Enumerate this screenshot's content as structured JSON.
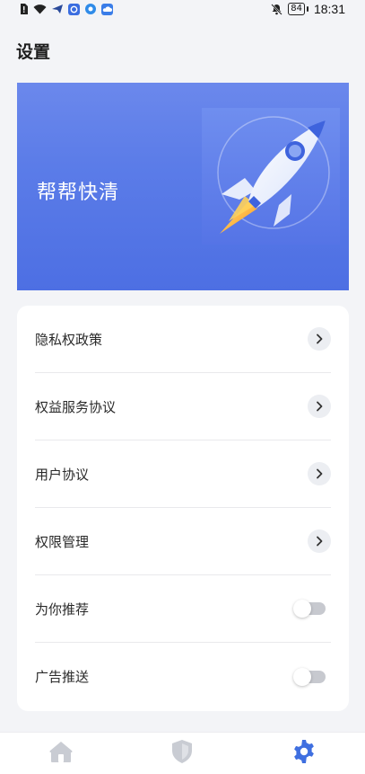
{
  "status_bar": {
    "left_icons": [
      "sim-alert-icon",
      "wifi-icon",
      "send-icon",
      "app-badge-icon",
      "app-circle-icon",
      "cloud-icon"
    ],
    "mute_icon": "bell-off-icon",
    "battery": "84",
    "time": "18:31"
  },
  "header": {
    "title": "设置"
  },
  "banner": {
    "title": "帮帮快清",
    "art": "rocket-illustration"
  },
  "settings": {
    "items": [
      {
        "label": "隐私权政策",
        "control": "chevron"
      },
      {
        "label": "权益服务协议",
        "control": "chevron"
      },
      {
        "label": "用户协议",
        "control": "chevron"
      },
      {
        "label": "权限管理",
        "control": "chevron"
      },
      {
        "label": "为你推荐",
        "control": "toggle",
        "on": false
      },
      {
        "label": "广告推送",
        "control": "toggle",
        "on": false
      }
    ]
  },
  "bottom_nav": {
    "items": [
      {
        "icon": "home-icon",
        "active": false
      },
      {
        "icon": "shield-icon",
        "active": false
      },
      {
        "icon": "gear-icon",
        "active": true
      }
    ]
  },
  "colors": {
    "accent": "#3f6fe0",
    "banner": "#5b7ce8",
    "inactive_icon": "#c9ccd3",
    "page_bg": "#f3f4f7"
  }
}
